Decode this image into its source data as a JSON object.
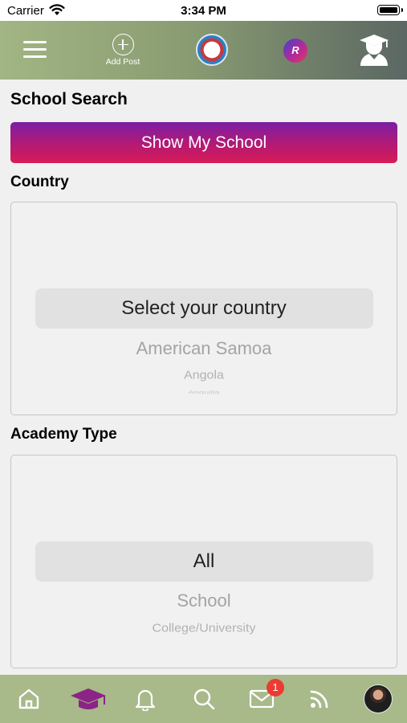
{
  "status_bar": {
    "carrier": "Carrier",
    "time": "3:34 PM"
  },
  "top_nav": {
    "add_post_label": "Add Post",
    "r_badge": "R"
  },
  "page": {
    "title": "School Search",
    "show_school_button": "Show My School"
  },
  "country": {
    "label": "Country",
    "selected": "Select your country",
    "options_below": [
      "American Samoa",
      "Angola",
      "Anguilla"
    ]
  },
  "academy": {
    "label": "Academy Type",
    "selected": "All",
    "options_below": [
      "School",
      "College/University"
    ]
  },
  "tab_bar": {
    "messages_badge": "1"
  },
  "colors": {
    "button_gradient_top": "#7b1ea5",
    "button_gradient_bottom": "#d81b56",
    "nav_green": "#a2b584",
    "tab_bar_green": "#a8b98a",
    "active_tab": "#8c2386",
    "badge_red": "#ec3b32"
  }
}
